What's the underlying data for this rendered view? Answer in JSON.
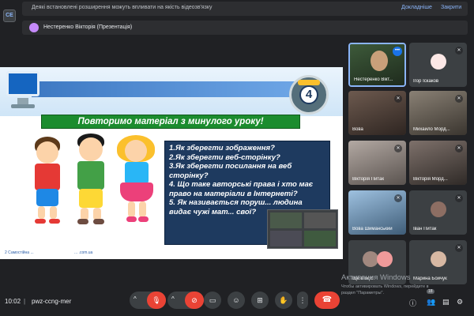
{
  "notice": {
    "text": "Деякі встановлені розширення можуть впливати на якість відеозв'язку",
    "link_more": "Докладніше",
    "link_close": "Закрити"
  },
  "presenter": {
    "label": "Нестеренко Вікторія (Презентація)"
  },
  "slide": {
    "badge_number": "4",
    "banner": "Повторимо матеріал з минулого уроку!",
    "questions": [
      "1.Як зберегти зображення?",
      "2.Як зберегти веб-сторінку?",
      "3.Як зберегти посилання на веб сторінку?",
      "4. Що таке авторські права і хто має право на матеріали в Інтернеті?",
      "5. Як називається поруш... людина видає чужі мат... свої?"
    ],
    "footer_left": "2 Самостійна ...",
    "footer_right": "... .com.ua"
  },
  "participants": [
    {
      "name": "Нестеренко Вікт...",
      "color": "#2b3a2a"
    },
    {
      "name": "Ігор Іскаков",
      "color": "#3c4043"
    },
    {
      "name": "Вова",
      "color": "#4a3d37"
    },
    {
      "name": "Михайло Морд...",
      "color": "#5a5148"
    },
    {
      "name": "Вікторія Питак",
      "color": "#7a6e68"
    },
    {
      "name": "Вікторія Морд...",
      "color": "#574f4c"
    },
    {
      "name": "Вова Шиманський",
      "color": "#5e7a94"
    },
    {
      "name": "Іван Питак",
      "color": "#3c4043"
    },
    {
      "name": "Ще 8 осіб",
      "color": "#3c4043"
    },
    {
      "name": "Марина Бойчук",
      "color": "#3c4043"
    }
  ],
  "watermark": {
    "title": "Активация Windows",
    "line1": "Чтобы активировать Windows, перейдите в",
    "line2": "раздел \"Параметры\"."
  },
  "bottom_bar": {
    "time": "10:02",
    "separator": "|",
    "meeting_code": "pwz-ccng-mer",
    "people_count": "18"
  },
  "icons": {
    "mic": "microphone-off-icon",
    "cam": "camera-off-icon",
    "captions": "captions-icon",
    "emoji": "emoji-icon",
    "present": "present-icon",
    "hand": "raise-hand-icon",
    "more": "more-vert-icon",
    "end": "end-call-icon",
    "info": "info-icon",
    "people": "people-icon",
    "chat": "chat-icon",
    "activities": "activities-icon"
  },
  "colors": {
    "background": "#202124",
    "accent_red": "#ea4335",
    "banner_green": "#1b8c2e",
    "question_box": "#1e3a5f"
  }
}
